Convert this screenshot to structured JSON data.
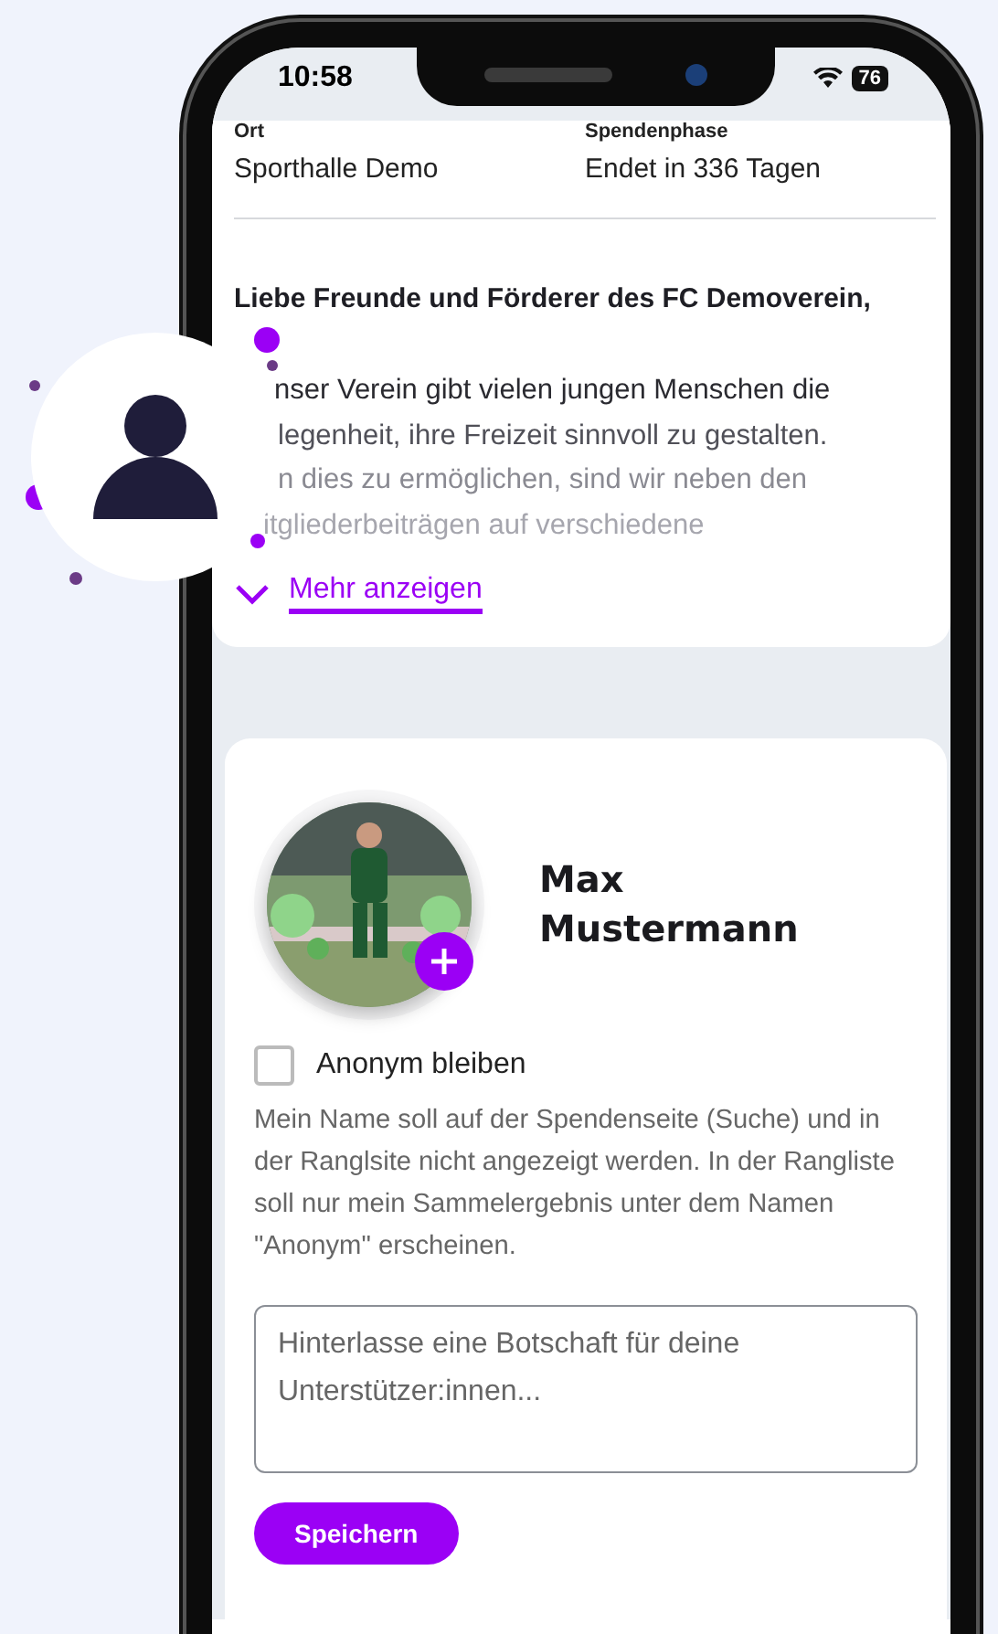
{
  "status_bar": {
    "time": "10:58",
    "battery": "76"
  },
  "info": [
    {
      "label": "Ort",
      "value": "Sporthalle Demo"
    },
    {
      "label": "Spendenphase",
      "value": "Endet in 336 Tagen"
    }
  ],
  "letter": {
    "heading": "Liebe Freunde und Förderer des FC Demoverein,",
    "lines": [
      "nser Verein gibt vielen jungen Menschen die",
      "legenheit, ihre Freizeit sinnvoll zu gestalten.",
      "n dies zu ermöglichen, sind wir neben den",
      "itgliederbeiträgen auf verschiedene"
    ],
    "more_link": "Mehr anzeigen"
  },
  "profile": {
    "name": "Max Mustermann"
  },
  "anonymous": {
    "label": "Anonym bleiben",
    "checked": false,
    "description": "Mein Name soll auf der Spendenseite (Suche) und in der Ranglsite nicht angezeigt werden. In der Rangliste soll nur mein Sammelergebnis unter dem Namen \"Anonym\" erscheinen."
  },
  "message": {
    "placeholder": "Hinterlasse eine Botschaft für deine Unterstützer:innen..."
  },
  "save_button": "Speichern"
}
